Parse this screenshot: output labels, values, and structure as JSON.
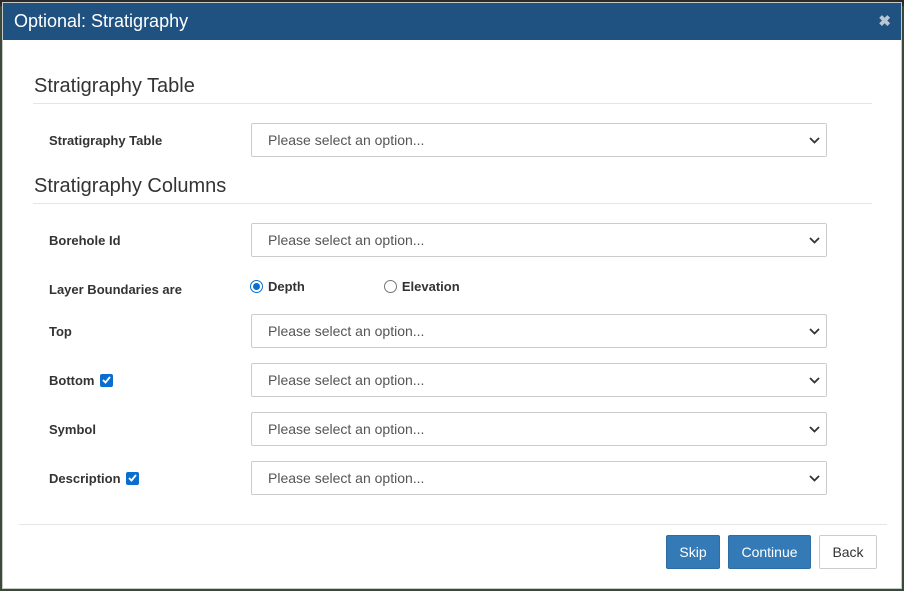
{
  "dialog": {
    "title": "Optional: Stratigraphy",
    "close_icon": "✖"
  },
  "sections": {
    "table_heading": "Stratigraphy Table",
    "columns_heading": "Stratigraphy Columns"
  },
  "fields": {
    "strat_table": {
      "label": "Stratigraphy Table",
      "value": "Please select an option..."
    },
    "borehole_id": {
      "label": "Borehole Id",
      "value": "Please select an option..."
    },
    "layer_boundaries": {
      "label": "Layer Boundaries are",
      "option_depth": "Depth",
      "option_elevation": "Elevation",
      "selected": "Depth"
    },
    "top": {
      "label": "Top",
      "value": "Please select an option..."
    },
    "bottom": {
      "label": "Bottom",
      "value": "Please select an option...",
      "checked": true
    },
    "symbol": {
      "label": "Symbol",
      "value": "Please select an option..."
    },
    "description": {
      "label": "Description",
      "value": "Please select an option...",
      "checked": true
    }
  },
  "footer": {
    "skip_label": "Skip",
    "continue_label": "Continue",
    "back_label": "Back"
  },
  "colors": {
    "titlebar": "#1f5281",
    "primary": "#337ab7",
    "accent": "#0a6ed1"
  }
}
